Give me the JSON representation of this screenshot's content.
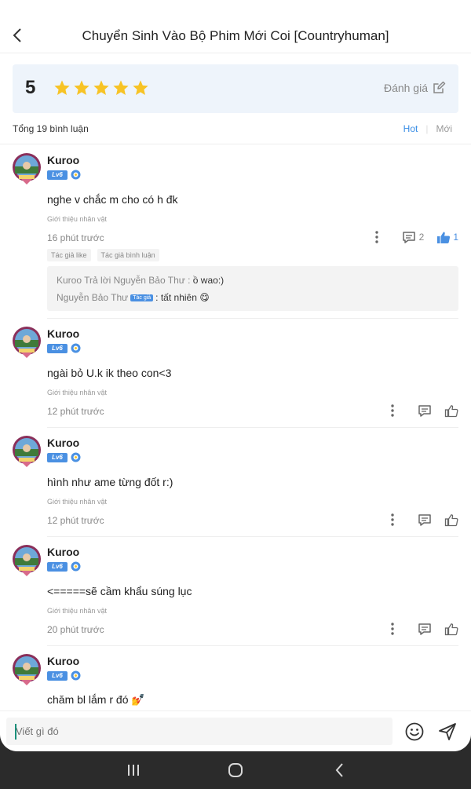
{
  "header": {
    "title": "Chuyển Sinh Vào Bộ Phim Mới Coi [Countryhuman]"
  },
  "rating": {
    "score": "5",
    "stars": 5,
    "star_color": "#f7c325",
    "rate_label": "Đánh giá"
  },
  "summary": {
    "total_label": "Tổng 19 bình luận",
    "sort_hot": "Hot",
    "sort_new": "Mới",
    "active_sort_color": "#3a8ee6"
  },
  "badge": {
    "level": "Lv6",
    "color": "#4a90e2"
  },
  "comments": [
    {
      "user": "Kuroo",
      "text": "nghe v chắc m cho có h đk",
      "tag": "Giới thiệu nhân vật",
      "time": "16 phút trước",
      "reply_count": "2",
      "like_count": "1",
      "chips": [
        "Tác giả like",
        "Tác giả bình luận"
      ],
      "replies": [
        {
          "author": "Kuroo",
          "target": "Trả lời Nguyễn Bảo Thư :",
          "text": "ồ wao:)"
        },
        {
          "author": "Nguyễn Bảo Thư",
          "author_tag": "Tác giả",
          "text": ": tất nhiên 😋"
        }
      ]
    },
    {
      "user": "Kuroo",
      "text": "ngài bỏ U.k ik theo con<3",
      "tag": "Giới thiệu nhân vật",
      "time": "12 phút trước"
    },
    {
      "user": "Kuroo",
      "text": "hình như  ame từng đốt r:)",
      "tag": "Giới thiệu nhân vật",
      "time": "12 phút trước"
    },
    {
      "user": "Kuroo",
      "text": "<=====sẽ cầm khẩu súng lục",
      "tag": "Giới thiệu nhân vật",
      "time": "20 phút trước"
    },
    {
      "user": "Kuroo",
      "text": "chăm bl lắm r đó 💅"
    }
  ],
  "input": {
    "placeholder": "Viết gì đó"
  },
  "icons": {
    "back": "chevron-left-icon",
    "rate": "edit-icon",
    "more": "more-vertical-icon",
    "reply": "comment-icon",
    "like": "thumbs-up-icon",
    "emoji": "smile-icon",
    "send": "send-icon",
    "nav": [
      "recents-icon",
      "home-icon",
      "back-icon"
    ]
  }
}
